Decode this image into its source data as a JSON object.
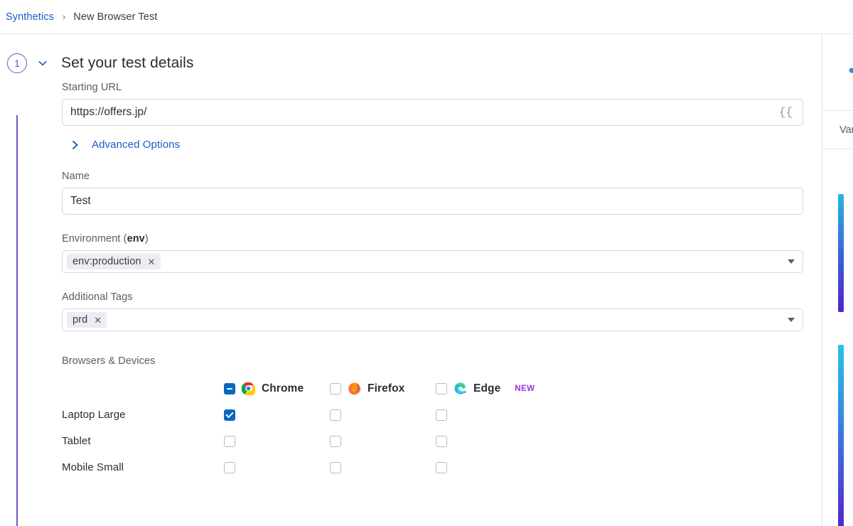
{
  "breadcrumb": {
    "root_label": "Synthetics",
    "separator": "›",
    "current_label": "New Browser Test"
  },
  "step": {
    "number": "1",
    "title": "Set your test details",
    "collapse_icon": "chevron-down-icon"
  },
  "form": {
    "starting_url": {
      "label": "Starting URL",
      "value": "https://offers.jp/",
      "variable_icon": "{{"
    },
    "advanced_options": {
      "label": "Advanced Options",
      "icon": "chevron-right-icon"
    },
    "name": {
      "label": "Name",
      "value": "Test"
    },
    "environment": {
      "label_prefix": "Environment (",
      "label_bold": "env",
      "label_suffix": ")",
      "chips": [
        {
          "text": "env:production",
          "remove": "✕"
        }
      ]
    },
    "additional_tags": {
      "label": "Additional Tags",
      "chips": [
        {
          "text": "prd",
          "remove": "✕"
        }
      ]
    }
  },
  "browsers_devices": {
    "label": "Browsers & Devices",
    "columns": [
      {
        "name": "Chrome",
        "icon": "chrome-icon",
        "state": "indeterminate",
        "badge": ""
      },
      {
        "name": "Firefox",
        "icon": "firefox-icon",
        "state": "unchecked",
        "badge": ""
      },
      {
        "name": "Edge",
        "icon": "edge-icon",
        "state": "unchecked",
        "badge": "NEW"
      }
    ],
    "rows": [
      {
        "device": "Laptop Large",
        "checks": [
          "checked",
          "unchecked",
          "unchecked"
        ]
      },
      {
        "device": "Tablet",
        "checks": [
          "unchecked",
          "unchecked",
          "unchecked"
        ]
      },
      {
        "device": "Mobile Small",
        "checks": [
          "unchecked",
          "unchecked",
          "unchecked"
        ]
      }
    ]
  },
  "right_panel": {
    "logo_icon": "curly-brace-logo-icon",
    "header_label": "Var",
    "bars": [
      {
        "id": "bar-1"
      },
      {
        "id": "bar-2"
      }
    ]
  },
  "colors": {
    "link": "#1a5cc8",
    "step_accent": "#7c52c6",
    "checkbox_active": "#0a66c2",
    "badge_new": "#a033d8"
  }
}
